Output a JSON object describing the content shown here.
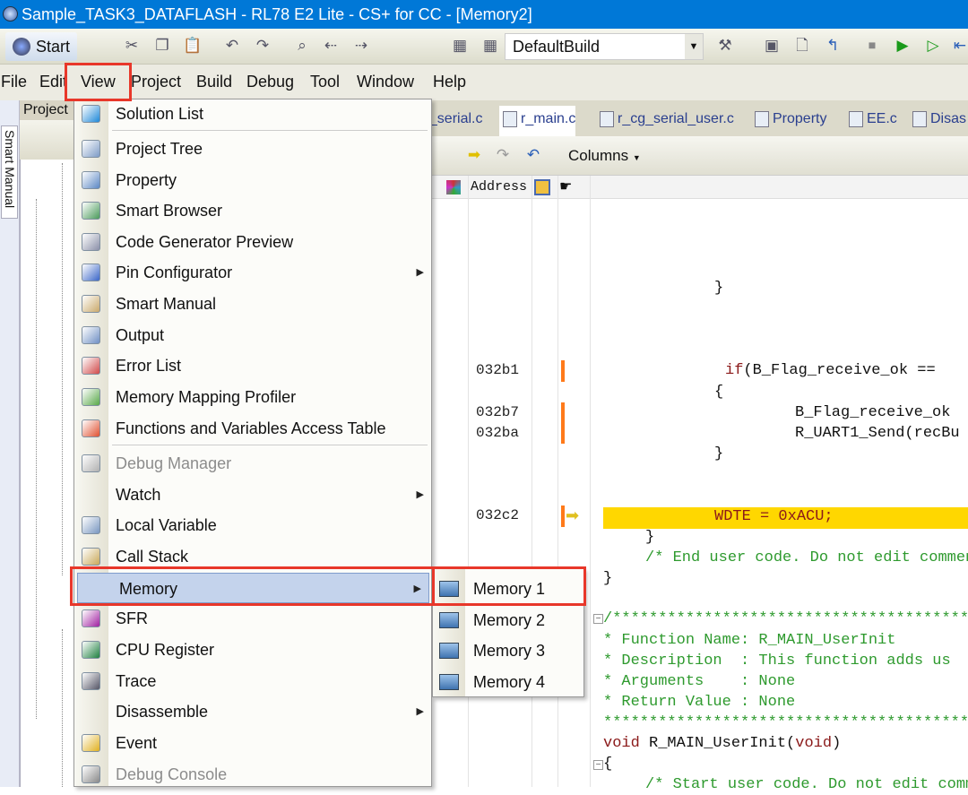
{
  "window": {
    "title": "Sample_TASK3_DATAFLASH - RL78 E2 Lite - CS+ for CC - [Memory2]"
  },
  "toolbar": {
    "start_label": "Start",
    "build_config": "DefaultBuild"
  },
  "menubar": {
    "items": [
      "File",
      "Edit",
      "View",
      "Project",
      "Build",
      "Debug",
      "Tool",
      "Window",
      "Help"
    ],
    "active": "View"
  },
  "left_panel": {
    "side_tab": "Smart Manual",
    "panel_title": "Project"
  },
  "tabs": [
    {
      "label": "g_serial.c"
    },
    {
      "label": "r_main.c",
      "active": true
    },
    {
      "label": "r_cg_serial_user.c"
    },
    {
      "label": "Property"
    },
    {
      "label": "EE.c"
    },
    {
      "label": "Disas"
    }
  ],
  "editor_toolbar": {
    "columns_label": "Columns"
  },
  "editor_header": {
    "address_label": "Address"
  },
  "view_menu": {
    "items": [
      {
        "label": "Solution List",
        "icon": "solution-list-icon",
        "color": "#1e88d8"
      },
      {
        "separator": true
      },
      {
        "label": "Project Tree",
        "icon": "project-tree-icon",
        "color": "#7d9bc6"
      },
      {
        "label": "Property",
        "icon": "property-icon",
        "color": "#5b87c4"
      },
      {
        "label": "Smart Browser",
        "icon": "smart-browser-icon",
        "color": "#4a9a5a"
      },
      {
        "label": "Code Generator Preview",
        "icon": "code-generator-icon",
        "color": "#8a8fa8"
      },
      {
        "label": "Pin Configurator",
        "icon": "pin-configurator-icon",
        "color": "#3a66c8",
        "submenu": true
      },
      {
        "label": "Smart Manual",
        "icon": "smart-manual-icon",
        "color": "#c9a86a"
      },
      {
        "label": "Output",
        "icon": "output-icon",
        "color": "#6f8fc4"
      },
      {
        "label": "Error List",
        "icon": "error-list-icon",
        "color": "#d04848"
      },
      {
        "label": "Memory Mapping Profiler",
        "icon": "memory-mapping-icon",
        "color": "#58a848"
      },
      {
        "label": "Functions and Variables Access Table",
        "icon": "access-table-icon",
        "color": "#e05030"
      },
      {
        "separator": true
      },
      {
        "label": "Debug Manager",
        "icon": "debug-manager-icon",
        "color": "#b0b0b0",
        "disabled": true
      },
      {
        "label": "Watch",
        "icon": "watch-icon",
        "color": "transparent",
        "submenu": true
      },
      {
        "label": "Local Variable",
        "icon": "local-variable-icon",
        "color": "#7896c0"
      },
      {
        "label": "Call Stack",
        "icon": "call-stack-icon",
        "color": "#c8a858"
      },
      {
        "label": "Memory",
        "icon": "memory-icon",
        "color": "transparent",
        "submenu": true,
        "highlighted": true
      },
      {
        "label": "SFR",
        "icon": "sfr-icon",
        "color": "#a020a0"
      },
      {
        "label": "CPU Register",
        "icon": "cpu-register-icon",
        "color": "#208040"
      },
      {
        "label": "Trace",
        "icon": "trace-icon",
        "color": "#556"
      },
      {
        "label": "Disassemble",
        "icon": "disassemble-icon",
        "color": "transparent",
        "submenu": true
      },
      {
        "label": "Event",
        "icon": "event-icon",
        "color": "#e0b020"
      },
      {
        "label": "Debug Console",
        "icon": "debug-console-icon",
        "color": "#888",
        "disabled": true
      }
    ]
  },
  "memory_submenu": {
    "items": [
      "Memory 1",
      "Memory 2",
      "Memory 3",
      "Memory 4"
    ],
    "selected": "Memory 1"
  },
  "code": {
    "addresses": [
      {
        "addr": "032b1"
      },
      {
        "addr": "032b7"
      },
      {
        "addr": "032ba"
      },
      {
        "addr": "032c2",
        "current": true
      }
    ],
    "lines": [
      {
        "text": "}",
        "cls": ""
      },
      {
        "text": "if",
        "cls": "kw",
        "rest": "(B_Flag_receive_ok ==",
        "restcls": ""
      },
      {
        "text": "{",
        "cls": ""
      },
      {
        "text": "B_Flag_receive_ok",
        "cls": ""
      },
      {
        "text": "R_UART1_Send(recBu",
        "cls": ""
      },
      {
        "text": "}",
        "cls": ""
      },
      {
        "text": "WDTE = 0xACU;",
        "cls": "kw"
      },
      {
        "text": "}",
        "cls": ""
      },
      {
        "text": "/* End user code. Do not edit comment",
        "cls": "cm"
      },
      {
        "text": "}",
        "cls": ""
      },
      {
        "text": "/*****************************************",
        "cls": "cm"
      },
      {
        "text": "* Function Name: R_MAIN_UserInit",
        "cls": "cm"
      },
      {
        "text": "* Description  : This function adds us",
        "cls": "cm"
      },
      {
        "text": "* Arguments    : None",
        "cls": "cm"
      },
      {
        "text": "* Return Value : None",
        "cls": "cm"
      },
      {
        "text": "******************************************",
        "cls": "cm"
      },
      {
        "text": "void",
        "cls": "kw",
        "rest": " R_MAIN_UserInit(",
        "restcls": "",
        "tail": "void",
        "tail2": ")"
      },
      {
        "text": "{",
        "cls": ""
      },
      {
        "text": "/* Start user code. Do not edit comm",
        "cls": "cm"
      }
    ]
  },
  "colors": {
    "titlebar": "#0078d7",
    "highlight_line": "#ffd700",
    "breakpoint_bar": "#ff7a1a",
    "annotation_box": "#e8372a",
    "menu_hover": "#c4d3ec"
  }
}
